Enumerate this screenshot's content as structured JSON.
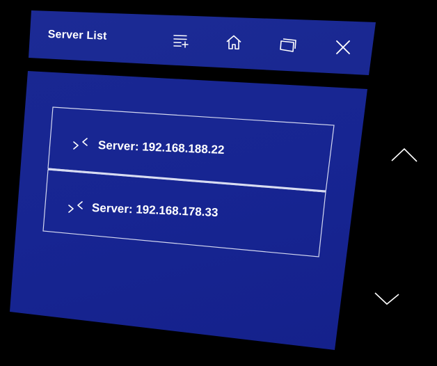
{
  "header": {
    "title": "Server List"
  },
  "toolbar": [
    {
      "name": "add-list-button",
      "icon": "list-add-icon"
    },
    {
      "name": "home-button",
      "icon": "home-icon"
    },
    {
      "name": "windows-button",
      "icon": "windows-icon"
    },
    {
      "name": "close-button",
      "icon": "close-icon"
    }
  ],
  "servers": [
    {
      "label": "Server: 192.168.188.22",
      "icon": "disconnected-icon"
    },
    {
      "label": "Server: 192.168.178.33",
      "icon": "disconnected-icon"
    }
  ],
  "scroll": {
    "up_icon": "chevron-up-icon",
    "down_icon": "chevron-down-icon"
  },
  "colors": {
    "background": "#000000",
    "panel": "#182691",
    "foreground": "#ffffff"
  }
}
